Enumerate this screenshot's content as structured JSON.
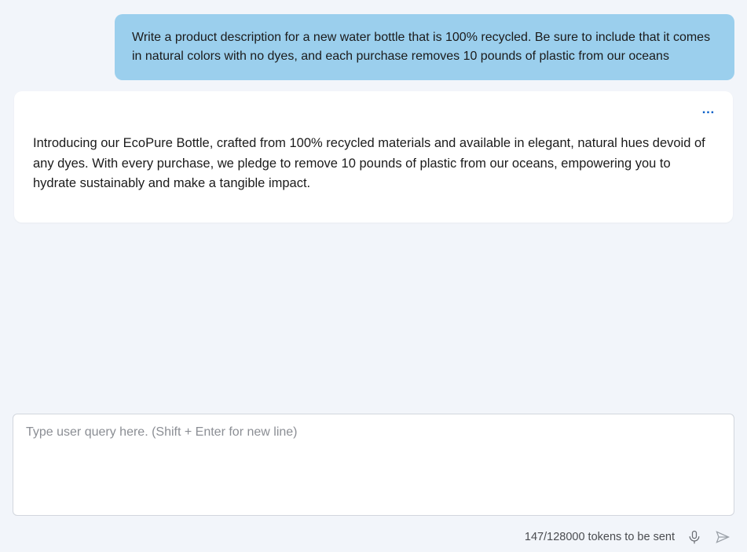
{
  "messages": {
    "user_prompt": "Write a product description for a new water bottle that is 100% recycled. Be sure to include that it comes in natural colors with no dyes, and each purchase removes 10 pounds of plastic from our oceans",
    "assistant_response": "Introducing our EcoPure Bottle, crafted from 100% recycled materials and available in elegant, natural hues devoid of any dyes. With every purchase, we pledge to remove 10 pounds of plastic from our oceans, empowering you to hydrate sustainably and make a tangible impact.",
    "more_actions_glyph": "…"
  },
  "composer": {
    "placeholder": "Type user query here. (Shift + Enter for new line)",
    "value": ""
  },
  "status": {
    "token_text": "147/128000 tokens to be sent"
  }
}
